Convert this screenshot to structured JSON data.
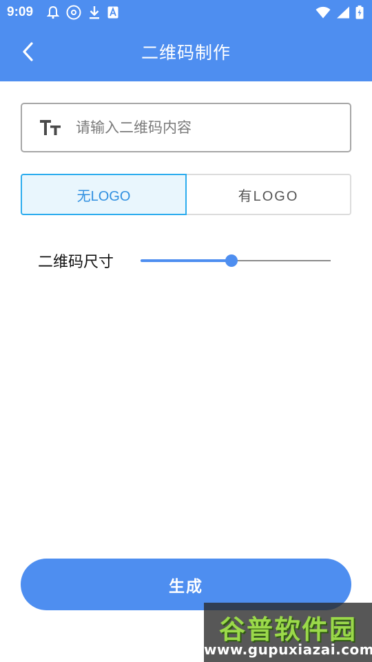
{
  "status_bar": {
    "time": "9:09",
    "left_icons": [
      "bell-icon",
      "disc-icon",
      "download-icon",
      "a-badge-icon"
    ],
    "right_icons": [
      "wifi-icon",
      "signal-icon",
      "battery-icon"
    ]
  },
  "app_bar": {
    "title": "二维码制作",
    "back_icon": "chevron-left-icon"
  },
  "input": {
    "placeholder": "请输入二维码内容",
    "value": "",
    "icon": "text-size-icon"
  },
  "logo_toggle": {
    "options": [
      {
        "label": "无LOGO",
        "selected": true
      },
      {
        "label": "有LOGO",
        "selected": false
      }
    ]
  },
  "size": {
    "label": "二维码尺寸",
    "slider_value_fraction": 0.48
  },
  "generate_button": {
    "label": "生成"
  },
  "watermark": {
    "logo_text": "谷普软件园",
    "url": "www.gupuxiazai.com"
  },
  "colors": {
    "primary": "#4e8ef0",
    "toggle_selected_border": "#2cacee",
    "toggle_selected_bg": "#e9f6fd",
    "toggle_selected_text": "#2f8fe0"
  }
}
